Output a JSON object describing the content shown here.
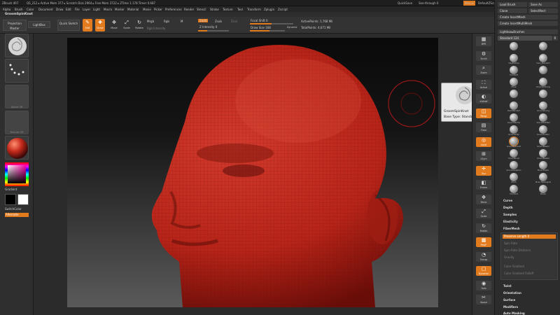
{
  "titlebar": {
    "app_name": "ZBrush 4R7",
    "info": "QS_212   ▸ Active Mem 377 ▸ Scratch Disk 2964 ▸ Free Mem 3722 ▸ ZTime 1.178 Timer 0.687",
    "quicksave": "QuickSave",
    "see_through": "See-through  0",
    "menus": "Menus",
    "default_zscript": "DefaultZScript"
  },
  "menubar": {
    "items": [
      "Alpha",
      "Brush",
      "Color",
      "Document",
      "Draw",
      "Edit",
      "File",
      "Layer",
      "Light",
      "Macro",
      "Marker",
      "Material",
      "Movie",
      "Picker",
      "Preferences",
      "Render",
      "Stencil",
      "Stroke",
      "Texture",
      "Tool",
      "Transform",
      "Zplugin",
      "Zscript"
    ]
  },
  "subtitle": {
    "brush_name": "GroomSpinKnot"
  },
  "shelf": {
    "projection_master": "Projection Master",
    "lightbox": "LightBox",
    "quick_sketch": "Quick Sketch",
    "tools": [
      {
        "glyph": "✎",
        "label": "Edit",
        "active": true
      },
      {
        "glyph": "✚",
        "label": "Draw",
        "active": true
      },
      {
        "glyph": "✥",
        "label": "Move",
        "active": false
      },
      {
        "glyph": "⤢",
        "label": "Scale",
        "active": false
      },
      {
        "glyph": "↻",
        "label": "Rotate",
        "active": false
      }
    ],
    "mrgb": "Mrgb",
    "rgb": "Rgb",
    "m": "M",
    "rgb_intensity": "Rgb Intensity",
    "zadd": "Zadd",
    "zsub": "Zsub",
    "zcut": "Zcut",
    "z_intensity": "Z Intensity 0",
    "focal_shift": "Focal Shift 0",
    "draw_size": "Draw Size 168",
    "dynamic": "Dynamic",
    "active_points": "ActivePoints: 1,768 Mil",
    "total_points": "TotalPoints: 4,671 Mil"
  },
  "leftshelf": {
    "thumbs": [
      "",
      "",
      "Alpha Off",
      "Texture Off",
      "",
      ""
    ],
    "gradient": "Gradient",
    "switch_color": "SwitchColor",
    "alternate": "Alternate"
  },
  "rightstrip": {
    "buttons": [
      {
        "glyph": "▦",
        "label": "BPR",
        "active": false
      },
      {
        "glyph": "⚙",
        "label": "Scroll",
        "active": false
      },
      {
        "glyph": "⌕",
        "label": "Zoom",
        "active": false
      },
      {
        "glyph": "⛶",
        "label": "Actual",
        "active": false
      },
      {
        "glyph": "◐",
        "label": "AAHalf",
        "active": false
      },
      {
        "glyph": "◫",
        "label": "Persp",
        "active": true
      },
      {
        "glyph": "▤",
        "label": "Floor",
        "active": false
      },
      {
        "glyph": "◎",
        "label": "Local",
        "active": true
      },
      {
        "glyph": "⊞",
        "label": "LSym",
        "active": false
      },
      {
        "glyph": "✛",
        "label": "Xyz",
        "active": true
      },
      {
        "glyph": "◧",
        "label": "Frame",
        "active": false
      },
      {
        "glyph": "✥",
        "label": "Move",
        "active": false
      },
      {
        "glyph": "⤢",
        "label": "Scale",
        "active": false
      },
      {
        "glyph": "↻",
        "label": "Rotate",
        "active": false
      },
      {
        "glyph": "▩",
        "label": "PolyF",
        "active": true
      },
      {
        "glyph": "◔",
        "label": "Transp",
        "active": false
      },
      {
        "glyph": "▢",
        "label": "Dynamic",
        "active": true
      },
      {
        "glyph": "◉",
        "label": "Solo",
        "active": false
      },
      {
        "glyph": "✂",
        "label": "Xpose",
        "active": false
      }
    ]
  },
  "rightpanel": {
    "load_brush": "Load Brush",
    "save_as": "Save As",
    "clone": "Clone",
    "selectrect": "SelectRect",
    "create_insertmesh": "Create InsertMesh",
    "create_insertmultimesh": "Create InsertMultiMesh",
    "lightbox_brushes": "Lightbox▸Brushes",
    "standard_label": "Standard  124",
    "r_badge": "R",
    "brushes": [
      "",
      "",
      "ClayBuildup",
      "Dam_Standard",
      "FormSoft",
      "",
      "Move",
      "GroomerStrong",
      "",
      "",
      "DamStandard",
      "GroomerLong",
      "GroomHairTip",
      "GroomHairBall",
      "GroomerTop",
      "GroomTurbler",
      "GroomSpinKnot",
      "GroomBlaster",
      "GroomBrush",
      "GroomBlaster",
      "GroomLengthen",
      "Move Elastic",
      "Pinch",
      "Move Topological",
      "FormSoft",
      "Planar"
    ],
    "subpalettes": [
      "Curve",
      "Depth",
      "Samples",
      "Elasticity",
      "FiberMesh",
      "Twist",
      "Orientation",
      "Surface",
      "Modifiers",
      "Auto Masking"
    ],
    "preserve_length": "Preserve Length 0",
    "dim_items": [
      "Spin Rate",
      "Spin Rate Distance",
      "Gravity",
      "Color Gradient",
      "Color Gradient Falloff"
    ]
  },
  "tooltip": {
    "name": "GroomSpinKnot",
    "base_type": "Base Type: Standard"
  },
  "colors": {
    "accent": "#e27a1e",
    "head_red": "#c4291f",
    "panel": "#2c2c2c",
    "background_top": "#0a0a0a"
  }
}
